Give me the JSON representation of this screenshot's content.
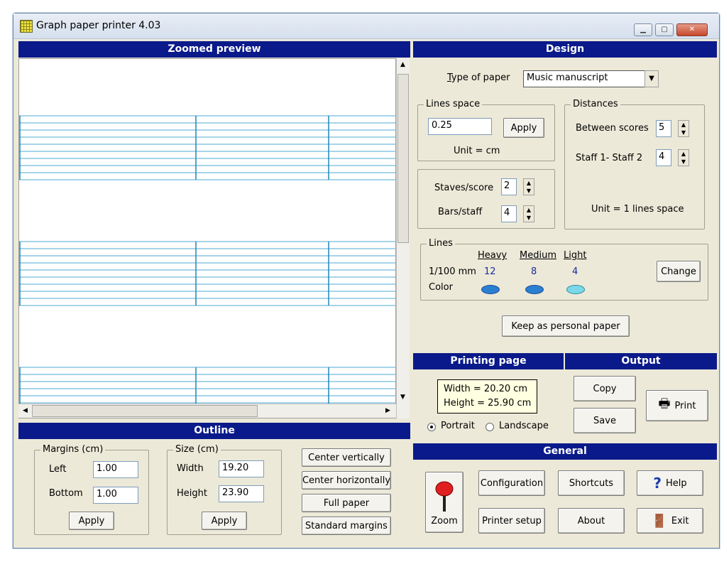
{
  "window": {
    "title": "Graph paper printer 4.03"
  },
  "preview": {
    "header": "Zoomed preview",
    "line_color": "#4ea9d4",
    "barline_color": "#1f86b8"
  },
  "design": {
    "header": "Design",
    "type_label": "Type of paper",
    "type_value": "Music manuscript",
    "lines_space": {
      "title": "Lines space",
      "value": "0.25",
      "apply": "Apply",
      "unit": "Unit = cm"
    },
    "distances": {
      "title": "Distances",
      "between_label": "Between scores",
      "between_value": "5",
      "staff_label": "Staff 1- Staff 2",
      "staff_value": "4",
      "unit": "Unit = 1 lines space"
    },
    "staves": {
      "staves_label": "Staves/score",
      "staves_value": "2",
      "bars_label": "Bars/staff",
      "bars_value": "4"
    },
    "lines": {
      "title": "Lines",
      "heavy": "Heavy",
      "medium": "Medium",
      "light": "Light",
      "row1_label": "1/100 mm",
      "heavy_val": "12",
      "medium_val": "8",
      "light_val": "4",
      "row2_label": "Color",
      "heavy_color": "#2a7fd0",
      "medium_color": "#2a7fd0",
      "light_color": "#7ad8e8",
      "change": "Change"
    },
    "keep": "Keep as personal paper"
  },
  "printing": {
    "header": "Printing page",
    "width": "Width = 20.20 cm",
    "height": "Height = 25.90 cm",
    "portrait": "Portrait",
    "landscape": "Landscape"
  },
  "output": {
    "header": "Output",
    "copy": "Copy",
    "save": "Save",
    "print": "Print"
  },
  "outline": {
    "header": "Outline",
    "margins": {
      "title": "Margins (cm)",
      "left_label": "Left",
      "left_value": "1.00",
      "bottom_label": "Bottom",
      "bottom_value": "1.00",
      "apply": "Apply"
    },
    "size": {
      "title": "Size (cm)",
      "width_label": "Width",
      "width_value": "19.20",
      "height_label": "Height",
      "height_value": "23.90",
      "apply": "Apply"
    },
    "center_vertically": "Center vertically",
    "center_horizontally": "Center horizontally",
    "full_paper": "Full paper",
    "standard_margins": "Standard margins"
  },
  "general": {
    "header": "General",
    "zoom": "Zoom",
    "configuration": "Configuration",
    "shortcuts": "Shortcuts",
    "help": "Help",
    "printer_setup": "Printer setup",
    "about": "About",
    "exit": "Exit"
  }
}
